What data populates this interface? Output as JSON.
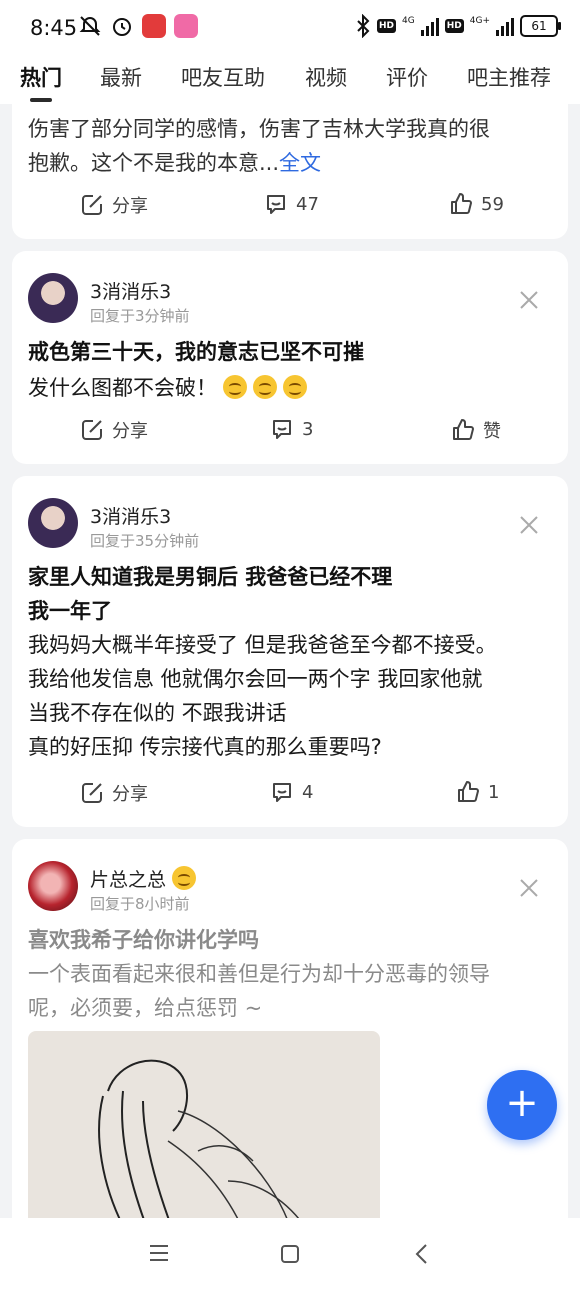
{
  "status": {
    "time": "8:45",
    "battery": "61",
    "net1": "4G",
    "net2": "4G+",
    "hd": "HD"
  },
  "tabs": [
    "热门",
    "最新",
    "吧友互助",
    "视频",
    "评价",
    "吧主推荐"
  ],
  "posts": [
    {
      "partial_line1": "伤害了部分同学的感情，伤害了吉林大学我真的很",
      "partial_line2": "抱歉。这个不是我的本意...",
      "more": "全文",
      "share": "分享",
      "comments": "47",
      "likes": "59"
    },
    {
      "user": "3消消乐3",
      "time": "回复于3分钟前",
      "title": "戒色第三十天，我的意志已坚不可摧",
      "body": "发什么图都不会破！",
      "share": "分享",
      "comments": "3",
      "likes": "赞"
    },
    {
      "user": "3消消乐3",
      "time": "回复于35分钟前",
      "title1": "家里人知道我是男铜后 我爸爸已经不理",
      "title2": "我一年了",
      "body1": "我妈妈大概半年接受了 但是我爸爸至今都不接受。",
      "body2": "我给他发信息 他就偶尔会回一两个字 我回家他就",
      "body3": "当我不存在似的 不跟我讲话",
      "body4": "真的好压抑 传宗接代真的那么重要吗?",
      "share": "分享",
      "comments": "4",
      "likes": "1"
    },
    {
      "user": "片总之总",
      "time": "回复于8小时前",
      "title": "喜欢我希子给你讲化学吗",
      "body1": "一个表面看起来很和善但是行为却十分恶毒的领导",
      "body2": "呢，必须要，给点惩罚 ~"
    }
  ],
  "fab": "+",
  "colors": {
    "accent": "#2e6ff2",
    "link": "#2f6ae0",
    "bg": "#f2f3f5"
  }
}
